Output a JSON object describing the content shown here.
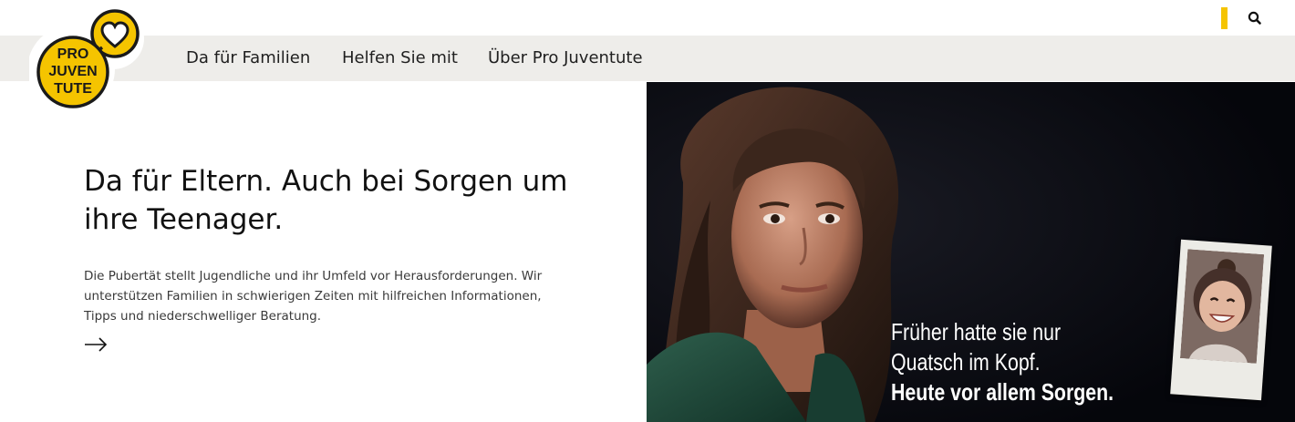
{
  "brand": {
    "logo_name": "Pro Juventute",
    "logo_lines": [
      "PRO",
      "JUVEN",
      "TUTE"
    ],
    "yellow": "#f5c400",
    "dark": "#1a1a1a"
  },
  "header": {
    "search_icon": "search-icon"
  },
  "nav": {
    "items": [
      {
        "label": "Da für Familien"
      },
      {
        "label": "Helfen Sie mit"
      },
      {
        "label": "Über Pro Juventute"
      }
    ]
  },
  "hero": {
    "title": "Da für Eltern. Auch bei Sorgen um ihre Teenager.",
    "description": "Die Pubertät stellt Jugendliche und ihr Umfeld vor Herausforderungen. Wir unterstützen Familien in schwierigen Zeiten mit hilfreichen Informationen, Tipps und niederschwelliger Beratung.",
    "arrow_icon": "arrow-right-icon"
  },
  "campaign": {
    "line1": "Früher hatte sie nur",
    "line2": "Quatsch im Kopf.",
    "line3": "Heute vor allem Sorgen."
  }
}
